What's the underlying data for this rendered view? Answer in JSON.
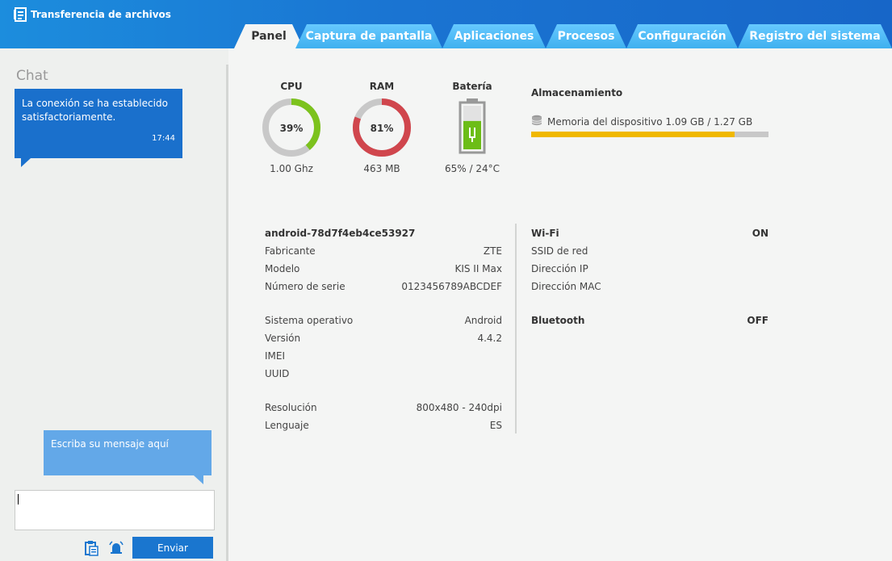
{
  "app": {
    "title": "Transferencia de archivos"
  },
  "tabs": [
    {
      "label": "Panel",
      "active": true
    },
    {
      "label": "Captura de pantalla",
      "active": false
    },
    {
      "label": "Aplicaciones",
      "active": false
    },
    {
      "label": "Procesos",
      "active": false
    },
    {
      "label": "Configuración",
      "active": false
    },
    {
      "label": "Registro del sistema",
      "active": false
    }
  ],
  "chat": {
    "title": "Chat",
    "incoming": {
      "text": "La conexión se ha establecido satisfactoriamente.",
      "time": "17:44"
    },
    "outgoing": {
      "text": "Escriba su mensaje aquí"
    },
    "input_value": "",
    "send_label": "Enviar"
  },
  "dashboard": {
    "cpu": {
      "title": "CPU",
      "percent_label": "39%",
      "percent": 39,
      "sub": "1.00 Ghz",
      "color": "#7cc21d"
    },
    "ram": {
      "title": "RAM",
      "percent_label": "81%",
      "percent": 81,
      "sub": "463 MB",
      "color": "#d0464d"
    },
    "battery": {
      "title": "Batería",
      "level": 65,
      "sub": "65% / 24°C",
      "color": "#6cbd17"
    },
    "storage": {
      "title": "Almacenamiento",
      "label": "Memoria del dispositivo 1.09 GB / 1.27 GB",
      "used_fraction": 0.858,
      "color": "#f0b800"
    }
  },
  "device": {
    "name": "android-78d7f4eb4ce53927",
    "group1": [
      {
        "label": "Fabricante",
        "value": "ZTE"
      },
      {
        "label": "Modelo",
        "value": "KIS II Max"
      },
      {
        "label": "Número de serie",
        "value": "0123456789ABCDEF"
      }
    ],
    "group2": [
      {
        "label": "Sistema operativo",
        "value": "Android"
      },
      {
        "label": "Versión",
        "value": "4.4.2"
      },
      {
        "label": "IMEI",
        "value": ""
      },
      {
        "label": "UUID",
        "value": ""
      }
    ],
    "group3": [
      {
        "label": "Resolución",
        "value": "800x480 - 240dpi"
      },
      {
        "label": "Lenguaje",
        "value": "ES"
      }
    ]
  },
  "network": {
    "wifi": {
      "label": "Wi-Fi",
      "status": "ON"
    },
    "wifi_rows": [
      {
        "label": "SSID de red",
        "value": ""
      },
      {
        "label": "Dirección IP",
        "value": ""
      },
      {
        "label": "Dirección MAC",
        "value": ""
      }
    ],
    "bluetooth": {
      "label": "Bluetooth",
      "status": "OFF"
    }
  }
}
